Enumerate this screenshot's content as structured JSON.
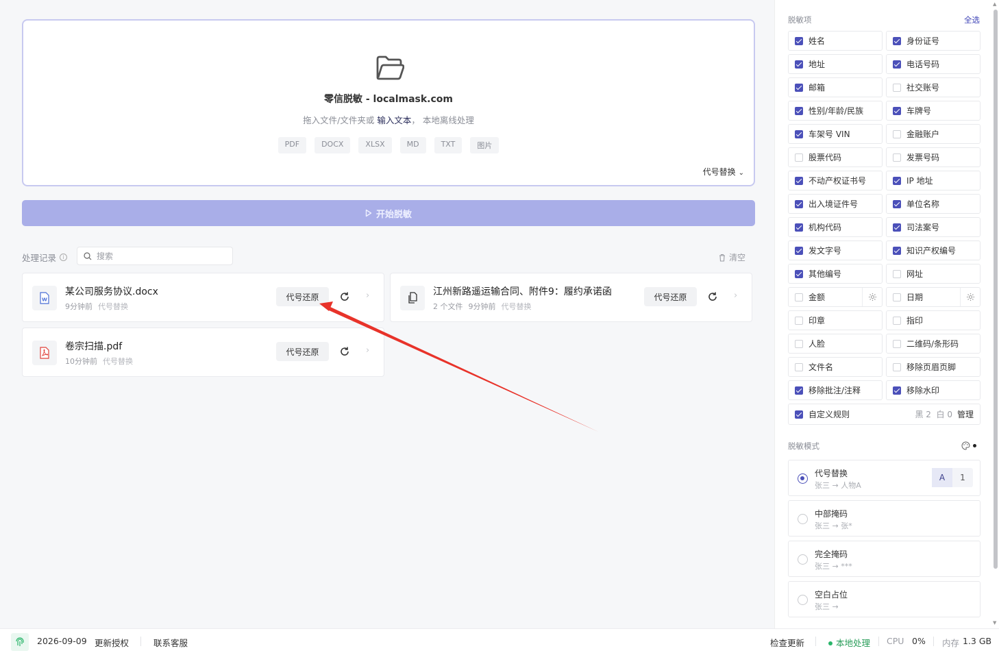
{
  "dropzone": {
    "title": "零信脱敏 - localmask.com",
    "sub_prefix": "拖入文件/文件夹或",
    "sub_link": "输入文本",
    "sub_suffix": "， 本地离线处理",
    "file_types": [
      "PDF",
      "DOCX",
      "XLSX",
      "MD",
      "TXT",
      "图片"
    ],
    "mode_label": "代号替换"
  },
  "start_button": "开始脱敏",
  "history": {
    "label": "处理记录",
    "search_placeholder": "搜索",
    "clear_label": "清空",
    "records": [
      {
        "name": "某公司服务协议.docx",
        "meta": [
          "9分钟前",
          "代号替换"
        ],
        "icon": "word-icon",
        "restore": "代号还原"
      },
      {
        "name": "江州新路遥运输合同、附件9：履约承诺函",
        "meta": [
          "2 个文件",
          "9分钟前",
          "代号替换"
        ],
        "icon": "files-icon",
        "restore": "代号还原"
      },
      {
        "name": "卷宗扫描.pdf",
        "meta": [
          "10分钟前",
          "代号替换"
        ],
        "icon": "pdf-icon",
        "restore": "代号还原"
      }
    ]
  },
  "sidebar": {
    "title": "脱敏项",
    "select_all": "全选",
    "options": [
      {
        "label": "姓名",
        "checked": true
      },
      {
        "label": "身份证号",
        "checked": true
      },
      {
        "label": "地址",
        "checked": true
      },
      {
        "label": "电话号码",
        "checked": true
      },
      {
        "label": "邮箱",
        "checked": true
      },
      {
        "label": "社交账号",
        "checked": false
      },
      {
        "label": "性别/年龄/民族",
        "checked": true
      },
      {
        "label": "车牌号",
        "checked": true
      },
      {
        "label": "车架号 VIN",
        "checked": true
      },
      {
        "label": "金融账户",
        "checked": false
      },
      {
        "label": "股票代码",
        "checked": false
      },
      {
        "label": "发票号码",
        "checked": false
      },
      {
        "label": "不动产权证书号",
        "checked": true
      },
      {
        "label": "IP 地址",
        "checked": true
      },
      {
        "label": "出入境证件号",
        "checked": true
      },
      {
        "label": "单位名称",
        "checked": true
      },
      {
        "label": "机构代码",
        "checked": true
      },
      {
        "label": "司法案号",
        "checked": true
      },
      {
        "label": "发文字号",
        "checked": true
      },
      {
        "label": "知识产权编号",
        "checked": true
      },
      {
        "label": "其他编号",
        "checked": true
      },
      {
        "label": "网址",
        "checked": false
      },
      {
        "label": "金额",
        "checked": false,
        "gear": true
      },
      {
        "label": "日期",
        "checked": false,
        "gear": true
      },
      {
        "label": "印章",
        "checked": false
      },
      {
        "label": "指印",
        "checked": false
      },
      {
        "label": "人脸",
        "checked": false
      },
      {
        "label": "二维码/条形码",
        "checked": false
      },
      {
        "label": "文件名",
        "checked": false
      },
      {
        "label": "移除页眉页脚",
        "checked": false
      },
      {
        "label": "移除批注/注释",
        "checked": true
      },
      {
        "label": "移除水印",
        "checked": true
      }
    ],
    "custom_rule": {
      "label": "自定义规则",
      "black": "黑 2",
      "white": "白 0",
      "manage": "管理",
      "checked": true
    },
    "mode_title": "脱敏模式",
    "modes": [
      {
        "name": "代号替换",
        "example": "张三 → 人物A",
        "selected": true,
        "toggle": [
          "A",
          "1"
        ]
      },
      {
        "name": "中部掩码",
        "example": "张三 → 张*",
        "selected": false
      },
      {
        "name": "完全掩码",
        "example": "张三 → ***",
        "selected": false
      },
      {
        "name": "空白占位",
        "example": "张三 →",
        "selected": false
      }
    ]
  },
  "footer": {
    "date": "2026-09-09",
    "update_license": "更新授权",
    "contact": "联系客服",
    "check_update": "检查更新",
    "local": "本地处理",
    "cpu_label": "CPU",
    "cpu_value": "0%",
    "mem_label": "内存",
    "mem_value": "1.3 GB"
  },
  "colors": {
    "accent": "#4b50b9",
    "button_disabled": "#a9aee8",
    "green": "#2ab56a",
    "arrow": "#e8332a"
  }
}
